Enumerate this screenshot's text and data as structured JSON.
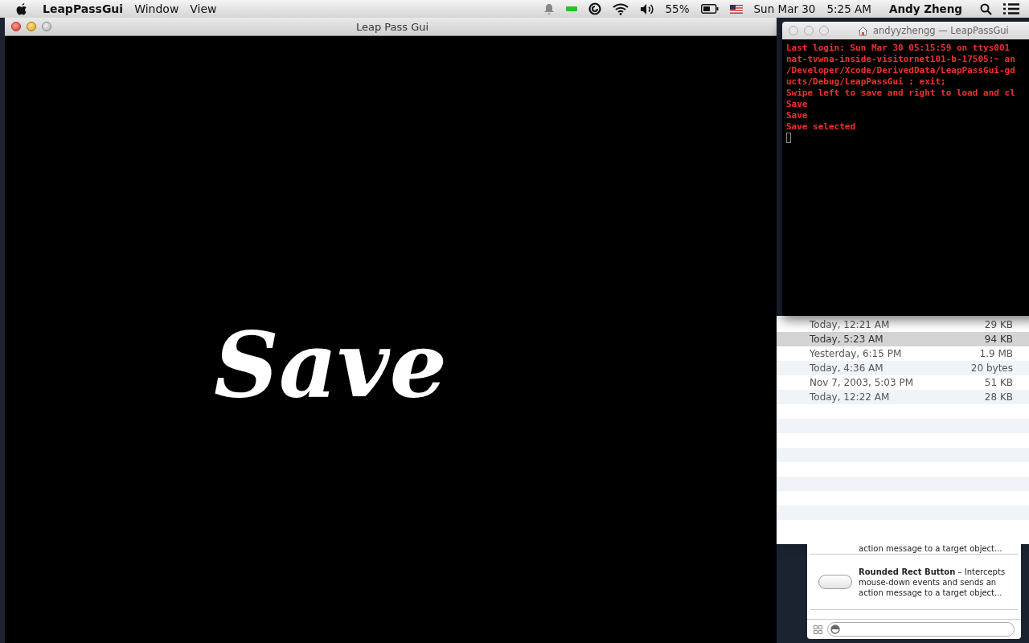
{
  "menubar": {
    "app_name": "LeapPassGui",
    "menus": [
      "Window",
      "View"
    ],
    "battery": "55%",
    "date": "Sun Mar 30",
    "time": "5:25 AM",
    "user": "Andy Zheng"
  },
  "app_window": {
    "title": "Leap Pass Gui",
    "display_text": "Save"
  },
  "terminal": {
    "title": "andyyzhengg — LeapPassGui",
    "lines": [
      "Last login: Sun Mar 30 05:15:59 on ttys001",
      "nat-tvwna-inside-visitornet101-b-17505:~ an",
      "/Developer/Xcode/DerivedData/LeapPassGui-gd",
      "ucts/Debug/LeapPassGui ; exit;",
      "Swipe left to save and right to load and cl",
      "Save",
      "Save",
      "Save selected"
    ]
  },
  "file_list": {
    "rows": [
      {
        "date": "Today, 12:21 AM",
        "size": "29 KB",
        "selected": false
      },
      {
        "date": "Today, 5:23 AM",
        "size": "94 KB",
        "selected": true
      },
      {
        "date": "Yesterday, 6:15 PM",
        "size": "1.9 MB",
        "selected": false
      },
      {
        "date": "Today, 4:36 AM",
        "size": "20 bytes",
        "selected": false
      },
      {
        "date": "Nov 7, 2003, 5:03 PM",
        "size": "51 KB",
        "selected": false
      },
      {
        "date": "Today, 12:22 AM",
        "size": "28 KB",
        "selected": false
      }
    ]
  },
  "object_library": {
    "cut_description": "action message to a target object...",
    "items": [
      {
        "name": "Rounded Rect Button",
        "description": " – Intercepts mouse-down events and sends an action message to a target object..."
      }
    ]
  }
}
